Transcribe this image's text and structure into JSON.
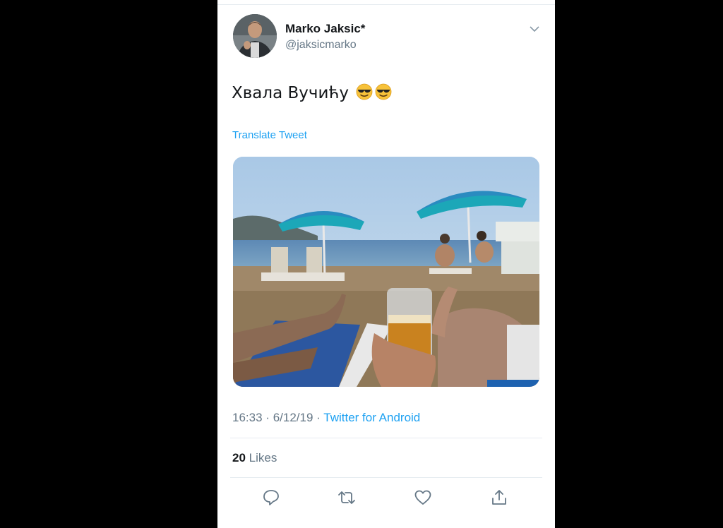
{
  "tweet": {
    "author_name": "Marko Jaksic*",
    "author_handle": "@jaksicmarko",
    "text": "Хвала Вучићу",
    "emojis": [
      "smiling-face-with-sunglasses",
      "smiling-face-with-sunglasses"
    ],
    "translate_label": "Translate Tweet",
    "time": "16:33",
    "date": "6/12/19",
    "separator": "·",
    "source": "Twitter for Android",
    "likes_count": "20",
    "likes_label": "Likes"
  },
  "icons": {
    "menu": "chevron-down-icon",
    "reply": "reply-icon",
    "retweet": "retweet-icon",
    "like": "heart-icon",
    "share": "share-icon"
  },
  "colors": {
    "link": "#1da1f2",
    "secondary_text": "#657786",
    "primary_text": "#14171a",
    "background": "#000000",
    "card": "#ffffff"
  }
}
